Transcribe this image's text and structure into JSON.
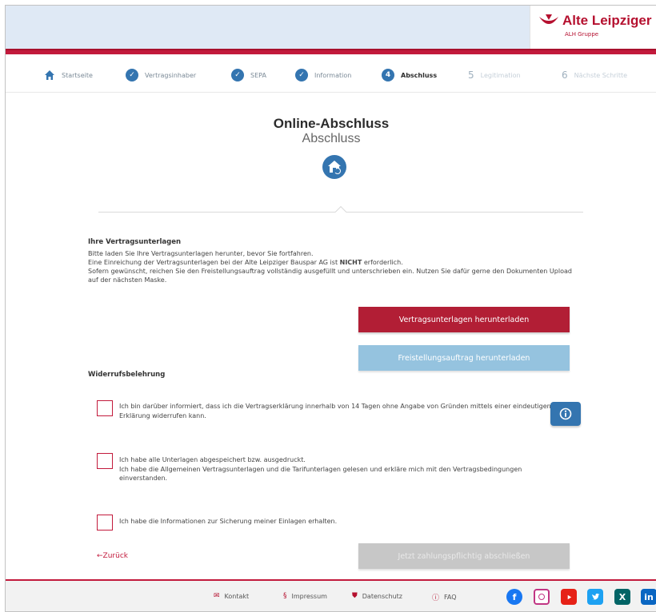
{
  "brand": {
    "name": "Alte Leipziger",
    "sub": "ALH Gruppe",
    "color": "#b5102f"
  },
  "stepper": {
    "home": "Startseite",
    "steps": [
      {
        "label": "Vertragsinhaber",
        "state": "done"
      },
      {
        "label": "SEPA",
        "state": "done"
      },
      {
        "label": "Information",
        "state": "done"
      },
      {
        "num": "4",
        "label": "Abschluss",
        "state": "active"
      },
      {
        "num": "5",
        "label": "Legitimation",
        "state": "future"
      },
      {
        "num": "6",
        "label": "Nächste Schritte",
        "state": "future"
      }
    ]
  },
  "title": "Online-Abschluss",
  "subtitle": "Abschluss",
  "documents": {
    "heading": "Ihre Vertragsunterlagen",
    "line1": "Bitte laden Sie Ihre Vertragsunterlagen herunter, bevor Sie fortfahren.",
    "line2_pre": "Eine Einreichung der Vertragsunterlagen bei der Alte Leipziger Bauspar AG ist ",
    "line2_bold": "NICHT",
    "line2_post": " erforderlich.",
    "line3": "Sofern gewünscht, reichen Sie den Freistellungsauftrag vollständig ausgefüllt und unterschrieben ein. Nutzen Sie dafür gerne den Dokumenten Upload auf der nächsten Maske."
  },
  "buttons": {
    "download_contract": "Vertragsunterlagen herunterladen",
    "download_exemption": "Freistellungsauftrag herunterladen",
    "submit": "Jetzt zahlungspflichtig abschließen"
  },
  "withdrawal": {
    "heading": "Widerrufsbelehrung",
    "checkbox1": "Ich bin darüber informiert, dass ich die Vertragserklärung innerhalb von 14 Tagen ohne Angabe von Gründen mittels einer eindeutigen Erklärung widerrufen kann.",
    "checkbox2_line1": "Ich habe alle Unterlagen abgespeichert bzw. ausgedruckt.",
    "checkbox2_line2": "Ich habe die Allgemeinen Vertragsunterlagen und die Tarifunterlagen gelesen und erkläre mich mit den Vertragsbedingungen einverstanden.",
    "checkbox3": "Ich habe die Informationen zur Sicherung meiner Einlagen erhalten."
  },
  "back": "←Zurück",
  "footer": {
    "contact": "Kontakt",
    "imprint": "Impressum",
    "privacy": "Datenschutz",
    "faq": "FAQ",
    "social_icons": [
      "facebook-icon",
      "instagram-icon",
      "youtube-icon",
      "twitter-icon",
      "xing-icon",
      "linkedin-icon"
    ]
  }
}
